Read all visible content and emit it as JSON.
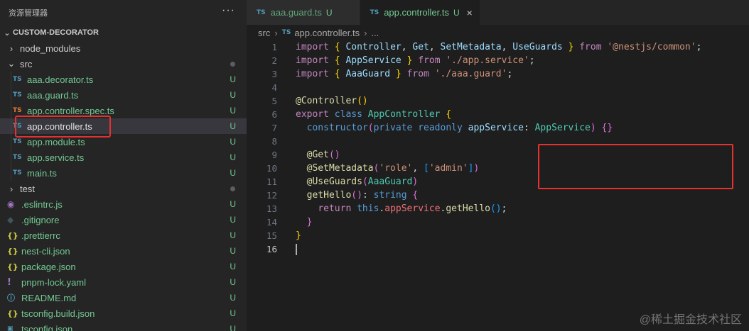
{
  "sidebar": {
    "title": "资源管理器",
    "more_icon": "ellipsis-icon",
    "section": "CUSTOM-DECORATOR",
    "items": [
      {
        "label": "node_modules",
        "kind": "folder",
        "expanded": false
      },
      {
        "label": "src",
        "kind": "folder",
        "expanded": true
      },
      {
        "label": "aaa.decorator.ts",
        "kind": "ts",
        "status": "U"
      },
      {
        "label": "aaa.guard.ts",
        "kind": "ts",
        "status": "U"
      },
      {
        "label": "app.controller.spec.ts",
        "kind": "ts-spec",
        "status": "U"
      },
      {
        "label": "app.controller.ts",
        "kind": "ts",
        "status": "U",
        "selected": true
      },
      {
        "label": "app.module.ts",
        "kind": "ts",
        "status": "U"
      },
      {
        "label": "app.service.ts",
        "kind": "ts",
        "status": "U"
      },
      {
        "label": "main.ts",
        "kind": "ts",
        "status": "U"
      },
      {
        "label": "test",
        "kind": "folder",
        "expanded": false
      },
      {
        "label": ".eslintrc.js",
        "kind": "eslint",
        "status": "U"
      },
      {
        "label": ".gitignore",
        "kind": "git",
        "status": "U"
      },
      {
        "label": ".prettierrc",
        "kind": "json",
        "status": "U"
      },
      {
        "label": "nest-cli.json",
        "kind": "json",
        "status": "U"
      },
      {
        "label": "package.json",
        "kind": "json",
        "status": "U"
      },
      {
        "label": "pnpm-lock.yaml",
        "kind": "yaml",
        "status": "U"
      },
      {
        "label": "README.md",
        "kind": "info",
        "status": "U"
      },
      {
        "label": "tsconfig.build.json",
        "kind": "json",
        "status": "U"
      },
      {
        "label": "tsconfig.json",
        "kind": "tsconfig",
        "status": "U"
      }
    ]
  },
  "tabs": [
    {
      "icon": "TS",
      "label": "aaa.guard.ts",
      "status": "U",
      "active": false
    },
    {
      "icon": "TS",
      "label": "app.controller.ts",
      "status": "U",
      "active": true,
      "close": "×"
    }
  ],
  "breadcrumb": {
    "folder": "src",
    "icon": "TS",
    "file": "app.controller.ts",
    "more": "..."
  },
  "editor": {
    "line_numbers": [
      "1",
      "2",
      "3",
      "4",
      "5",
      "6",
      "7",
      "8",
      "9",
      "10",
      "11",
      "12",
      "13",
      "14",
      "15",
      "16"
    ],
    "current_line": "16"
  },
  "watermark": "@稀土掘金技术社区",
  "colors": {
    "highlight_box": "#e8302e",
    "untracked": "#73c991",
    "ts_icon": "#519aba"
  }
}
